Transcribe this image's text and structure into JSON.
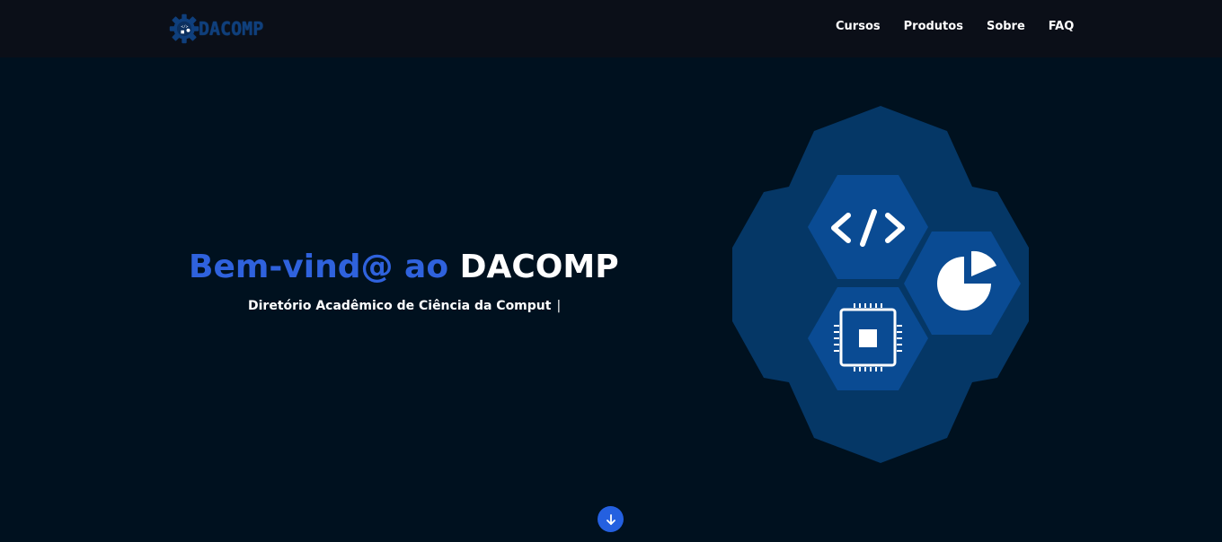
{
  "brand": {
    "name": "DACOMP",
    "logo_glyph": "</>",
    "colors": {
      "logo": "#0f3f7c",
      "accent": "#2f62dd",
      "gear": "#053766",
      "hex": "#0a4b93"
    }
  },
  "nav": {
    "links": [
      {
        "label": "Cursos"
      },
      {
        "label": "Produtos"
      },
      {
        "label": "Sobre"
      },
      {
        "label": "FAQ"
      }
    ]
  },
  "hero": {
    "title_accent": "Bem-vind@ ao",
    "title_brand": "DACOMP",
    "subtitle": "Diretório Acadêmico de Ciência da Comput",
    "cursor": "|",
    "illustration": {
      "icons": [
        "code-icon",
        "pie-chart-icon",
        "cpu-chip-icon"
      ]
    }
  },
  "scroll_button": {
    "icon": "arrow-down-icon"
  }
}
